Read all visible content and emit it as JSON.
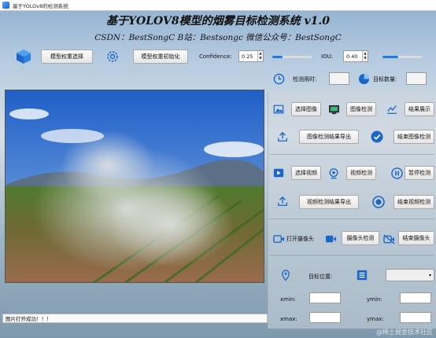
{
  "window": {
    "title": "基于YOLOv8的检测系统"
  },
  "header": {
    "title": "基于YOLOV8模型的烟雾目标检测系统 v1.0",
    "subtitle": "CSDN：BestSongC   B站：Bestsongc   微信公众号：BestSongC"
  },
  "toolbar": {
    "model_select_label": "模型权重选择",
    "model_init_label": "模型权重初始化",
    "confidence_label": "Confidence:",
    "confidence_value": "0.25",
    "confidence_level": 0.25,
    "iou_label": "IOU:",
    "iou_value": "0.40",
    "iou_level": 0.4
  },
  "stats": {
    "time_label": "检测用时:",
    "time_value": "",
    "count_label": "目标数量:",
    "count_value": ""
  },
  "image_section": {
    "select_label": "选择图像",
    "detect_label": "图像检测",
    "show_label": "结果展示",
    "export_label": "图像检测结果导出",
    "end_label": "结束图像检测"
  },
  "video_section": {
    "select_label": "选择视频",
    "detect_label": "视频检测",
    "pause_label": "暂停检测",
    "export_label": "视频检测结果导出",
    "end_label": "结束视频检测"
  },
  "camera_section": {
    "open_label": "打开摄像头",
    "detect_label": "摄像头检测",
    "end_label": "结束摄像头"
  },
  "target": {
    "position_label": "目标位置:",
    "xmin_label": "xmin:",
    "ymin_label": "ymin:",
    "xmax_label": "xmax:",
    "ymax_label": "ymax:",
    "xmin_value": "",
    "ymin_value": "",
    "xmax_value": "",
    "ymax_value": ""
  },
  "status": {
    "message": "图片打开成功！！！"
  },
  "watermark": "@稀土掘金技术社区",
  "colors": {
    "accent": "#1e7be0",
    "icon_blue": "#1a66c9"
  }
}
